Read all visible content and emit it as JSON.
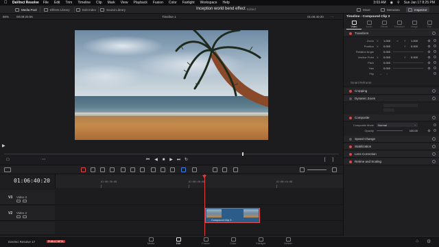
{
  "menubar": {
    "app": "DaVinci Resolve",
    "items": [
      "File",
      "Edit",
      "Trim",
      "Timeline",
      "Clip",
      "Mark",
      "View",
      "Playback",
      "Fusion",
      "Color",
      "Fairlight",
      "Workspace",
      "Help"
    ],
    "battery": "3:03 AM",
    "datetime": "Sun Jan 17  8:25 PM"
  },
  "toolbar": {
    "media_pool": "Media Pool",
    "effects_library": "Effects Library",
    "edit_index": "Edit Index",
    "sound_library": "Sound Library",
    "project_title": "Inception world bend effect",
    "project_status": "Edited",
    "mixer": "Mixer",
    "metadata": "Metadata",
    "inspector": "Inspector"
  },
  "viewer": {
    "zoom": "86%",
    "source_timecode": "00:09:20:06",
    "timeline_name": "Timeline 1",
    "record_timecode": "01:06:40:20"
  },
  "timeline": {
    "timecode": "01:06:40:20",
    "ruler": [
      "01:06:36:00",
      "01:06:40:00",
      "01:06:44:00"
    ],
    "tracks": [
      {
        "id": "V3",
        "name": "Video 3"
      },
      {
        "id": "V2",
        "name": "Video 2"
      }
    ],
    "clip_name": "Compound Clip 3"
  },
  "inspector": {
    "title": "Timeline - Compound Clip 3",
    "tabs": [
      "Video",
      "Audio",
      "Effects",
      "Transition",
      "Image",
      "File"
    ],
    "transform": {
      "label": "Transform",
      "zoom": {
        "label": "Zoom",
        "x": "1.000",
        "y": "1.000"
      },
      "position": {
        "label": "Position",
        "x": "0.000",
        "y": "0.000"
      },
      "rotation": {
        "label": "Rotation Angle",
        "value": "0.000"
      },
      "anchor": {
        "label": "Anchor Point",
        "x": "0.000",
        "y": "0.000"
      },
      "pitch": {
        "label": "Pitch",
        "value": "0.000"
      },
      "yaw": {
        "label": "Yaw",
        "value": "0.000"
      },
      "flip": {
        "label": "Flip"
      }
    },
    "smart_reframe": "Smart Reframe",
    "cropping": "Cropping",
    "dynamic_zoom": "Dynamic Zoom",
    "composite": {
      "label": "Composite",
      "mode_label": "Composite Mode",
      "mode_value": "Normal",
      "opacity_label": "Opacity",
      "opacity_value": "100.00"
    },
    "speed_change": "Speed Change",
    "stabilization": "Stabilization",
    "lens_correction": "Lens Correction",
    "retime": "Retime and Scaling"
  },
  "pages": [
    "Media",
    "Edit",
    "Fusion",
    "Color",
    "Fairlight",
    "Deliver"
  ],
  "brand": "DaVinci Resolve 17",
  "beta": "PUBLIC BETA"
}
